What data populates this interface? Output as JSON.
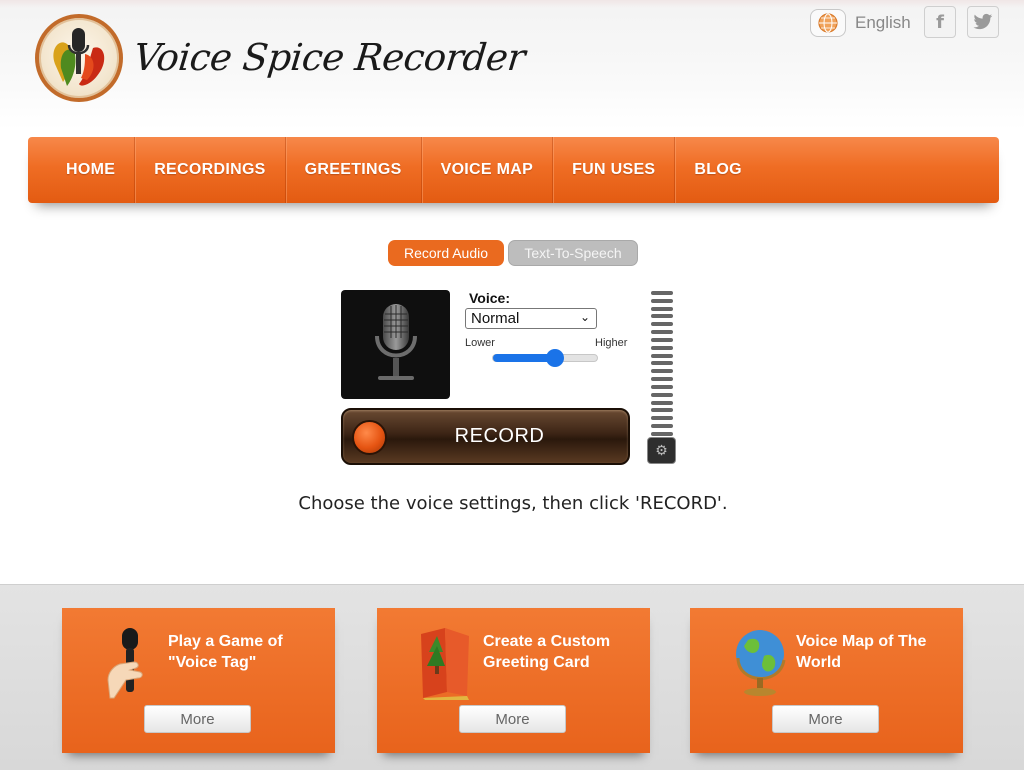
{
  "header": {
    "logo_text": "Voice Spice Recorder",
    "language": "English",
    "social": {
      "facebook_glyph": "f",
      "twitter_glyph": "t"
    }
  },
  "nav": {
    "items": [
      {
        "label": "HOME"
      },
      {
        "label": "RECORDINGS"
      },
      {
        "label": "GREETINGS"
      },
      {
        "label": "VOICE MAP"
      },
      {
        "label": "FUN USES"
      },
      {
        "label": "BLOG"
      }
    ]
  },
  "tabs": {
    "record_audio": "Record Audio",
    "text_to_speech": "Text-To-Speech"
  },
  "recorder": {
    "voice_label": "Voice:",
    "voice_selected": "Normal",
    "pitch_lower_label": "Lower",
    "pitch_higher_label": "Higher",
    "pitch_value_fraction": 0.6,
    "record_label": "RECORD",
    "instruction": "Choose the voice settings, then click 'RECORD'."
  },
  "cards": [
    {
      "title": "Play a Game of \"Voice Tag\"",
      "more_label": "More",
      "icon": "hand-microphone-icon"
    },
    {
      "title": "Create a Custom Greeting Card",
      "more_label": "More",
      "icon": "greeting-card-icon"
    },
    {
      "title": "Voice Map of The World",
      "more_label": "More",
      "icon": "globe-icon"
    }
  ],
  "colors": {
    "accent_orange": "#ef6d24",
    "record_brown": "#3b2415",
    "slider_blue": "#1a73e8"
  }
}
